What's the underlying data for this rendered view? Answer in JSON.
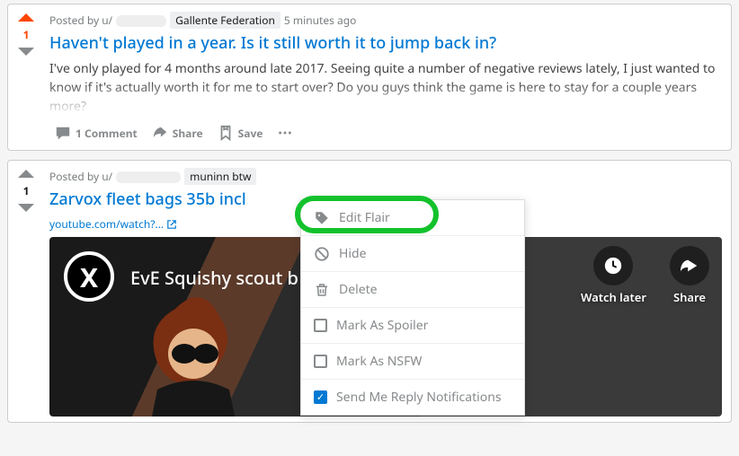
{
  "posts": [
    {
      "posted_by_prefix": "Posted by u/",
      "flair": "Gallente Federation",
      "time": "5 minutes ago",
      "score": "1",
      "vote_active": true,
      "title": "Haven't played in a year. Is it still worth it to jump back in?",
      "body": "I've only played for 4 months around late 2017. Seeing quite a number of negative reviews lately, I just wanted to know if it's actually worth it for me to start over? Do you guys think the game is here to stay for a couple years more?",
      "comments_count": "1 Comment",
      "share": "Share",
      "save": "Save"
    },
    {
      "posted_by_prefix": "Posted by u/",
      "flair": "muninn btw",
      "time": "",
      "score": "1",
      "vote_active": false,
      "title": "Zarvox fleet bags 35b incl",
      "source": "youtube.com/watch?...",
      "video_title": "EvE Squishy scout b",
      "watch_later": "Watch later",
      "share_vid": "Share"
    }
  ],
  "menu": {
    "edit_flair": "Edit Flair",
    "hide": "Hide",
    "delete": "Delete",
    "spoiler": "Mark As Spoiler",
    "nsfw": "Mark As NSFW",
    "notify": "Send Me Reply Notifications"
  }
}
